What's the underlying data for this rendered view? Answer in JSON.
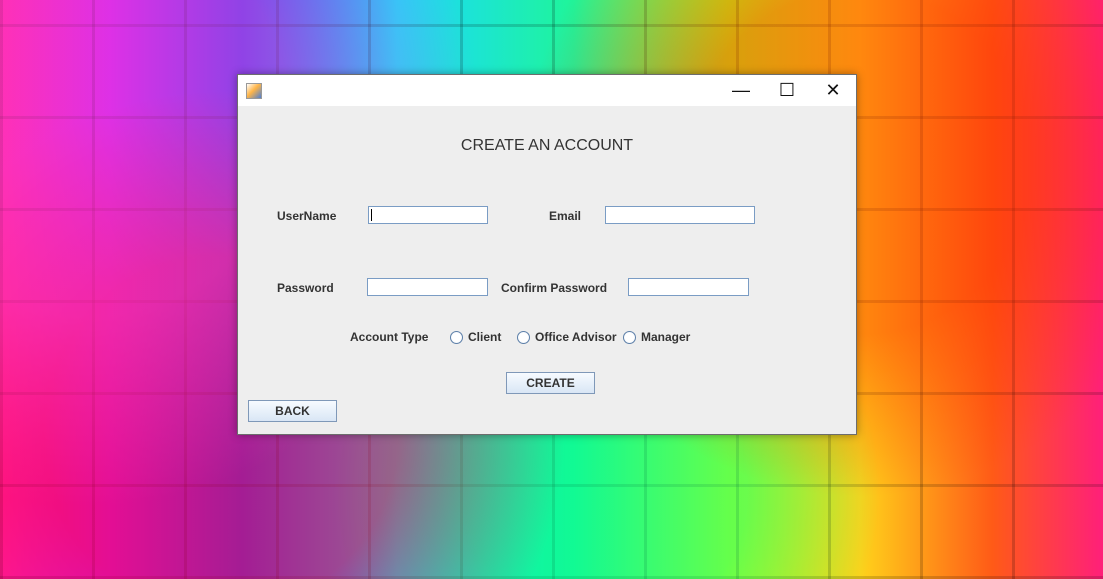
{
  "window": {
    "title": "",
    "controls": {
      "minimize": "—",
      "maximize": "☐",
      "close": "✕"
    },
    "icon": "java-app-icon"
  },
  "form": {
    "heading": "CREATE AN ACCOUNT",
    "username_label": "UserName",
    "email_label": "Email",
    "password_label": "Password",
    "confirm_password_label": "Confirm Password",
    "account_type_label": "Account Type",
    "account_types": [
      "Client",
      "Office Advisor",
      "Manager"
    ],
    "username_value": "",
    "email_value": "",
    "password_value": "",
    "confirm_password_value": ""
  },
  "buttons": {
    "create": "CREATE",
    "back": "BACK"
  }
}
